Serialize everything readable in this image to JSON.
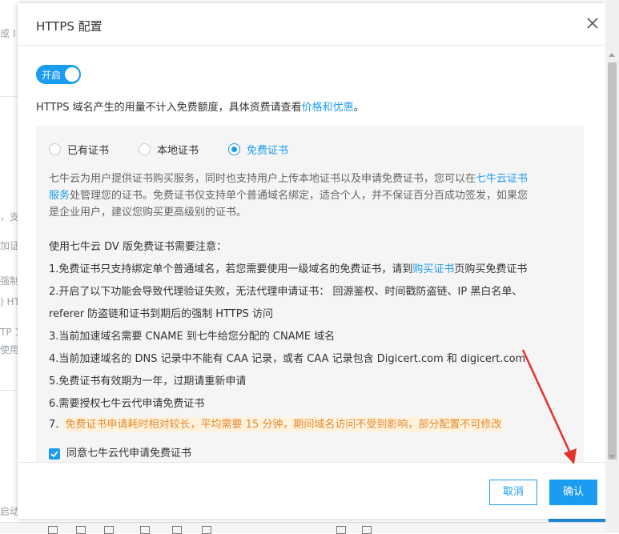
{
  "background": {
    "fragments": [
      "或 I",
      "，支",
      "加证",
      "强制",
      ") HT",
      "TP 1",
      "使用",
      "启动"
    ]
  },
  "modal": {
    "title": "HTTPS 配置",
    "toggle": {
      "label": "开启",
      "on": true
    },
    "note_text": "HTTPS 域名产生的用量不计入免费额度，具体资费请查看",
    "note_link": "价格和优惠",
    "note_end": "。",
    "cert_options": [
      {
        "label": "已有证书",
        "selected": false
      },
      {
        "label": "本地证书",
        "selected": false
      },
      {
        "label": "免费证书",
        "selected": true
      }
    ],
    "desc": {
      "part1": "七牛云为用户提供证书购买服务，同时也支持用户上传本地证书以及申请免费证书，您可以在",
      "link1": "七牛云证书",
      "link2": "服务",
      "part2": "处管理您的证书。免费证书仅支持单个普通域名绑定，适合个人，并不保证百分百成功签发，如果您",
      "part3": "是企业用户，建议您购买更高级别的证书。"
    },
    "notice": {
      "heading": "使用七牛云 DV 版免费证书需要注意：",
      "item1_a": "1.免费证书只支持绑定单个普通域名，若您需要使用一级域名的免费证书，请到",
      "item1_link": "购买证书",
      "item1_b": "页购买免费证书",
      "item2_a": "2.开启了以下功能会导致代理验证失败，无法代理申请证书： 回源鉴权、时间戳防盗链、IP 黑白名单、",
      "item2_b": "referer 防盗链和证书到期后的强制 HTTPS 访问",
      "item3": "3.当前加速域名需要 CNAME 到七牛给您分配的 CNAME 域名",
      "item4": "4.当前加速域名的 DNS 记录中不能有 CAA 记录，或者 CAA 记录包含 Digicert.com 和 digicert.com",
      "item5": "5.免费证书有效期为一年，过期请重新申请",
      "item6": "6.需要授权七牛云代申请免费证书",
      "item7_num": "7.",
      "item7_text": "免费证书申请耗时相对较长，平均需要 15 分钟，期间域名访问不受到影响，部分配置不可修改"
    },
    "agree_label": "同意七牛云代申请免费证书",
    "agree_checked": true,
    "cancel_label": "取消",
    "confirm_label": "确认"
  },
  "colors": {
    "accent": "#1a9cf0",
    "warning": "#e6882a",
    "annotation": "#e5332a"
  }
}
